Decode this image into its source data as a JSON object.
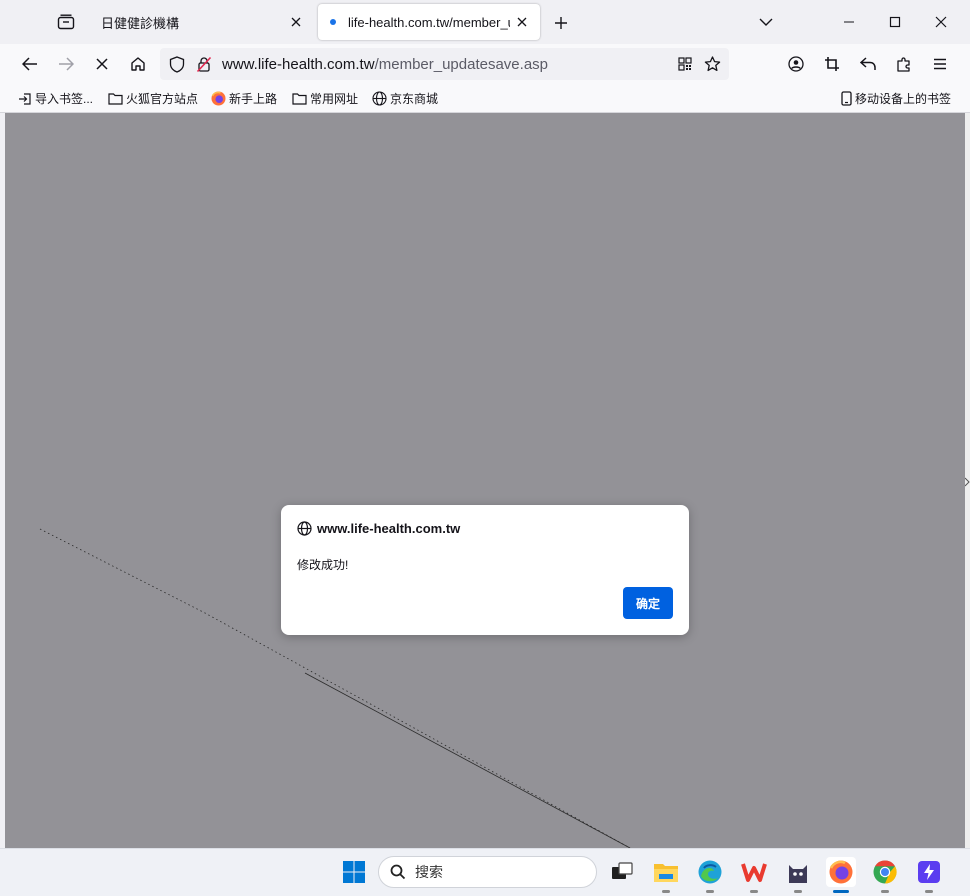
{
  "tabs": [
    {
      "title": "日健健診機構",
      "active": false
    },
    {
      "title": "life-health.com.tw/member_u",
      "active": true
    }
  ],
  "urlbar": {
    "host": "www.life-health.com.tw",
    "path": "/member_updatesave.asp"
  },
  "bookmarks": [
    {
      "label": "导入书签...",
      "icon": "import-icon"
    },
    {
      "label": "火狐官方站点",
      "icon": "folder-icon"
    },
    {
      "label": "新手上路",
      "icon": "firefox-icon"
    },
    {
      "label": "常用网址",
      "icon": "folder-icon"
    },
    {
      "label": "京东商城",
      "icon": "globe-icon"
    }
  ],
  "mobile_bookmarks": "移动设备上的书签",
  "dialog": {
    "origin": "www.life-health.com.tw",
    "message": "修改成功!",
    "ok_label": "确定"
  },
  "taskbar": {
    "search_label": "搜索"
  },
  "colors": {
    "accent": "#0061e0",
    "overlay": "#939297"
  }
}
